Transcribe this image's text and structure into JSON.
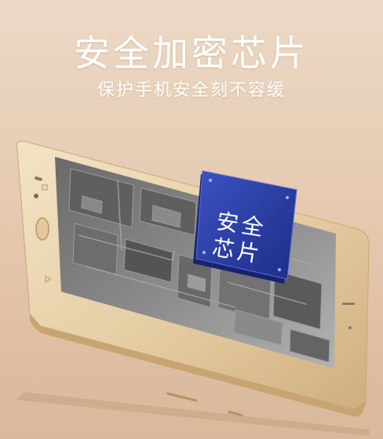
{
  "hero": {
    "title": "安全加密芯片",
    "subtitle": "保护手机安全刻不容缓"
  },
  "chip": {
    "label_line1": "安全",
    "label_line2": "芯片"
  },
  "colors": {
    "background_top": "#ecd9c6",
    "background_bottom": "#d9b89b",
    "phone_body": "#e9d4ad",
    "chip_blue": "#2a3fa8",
    "board_gray": "#7c7c7c"
  }
}
